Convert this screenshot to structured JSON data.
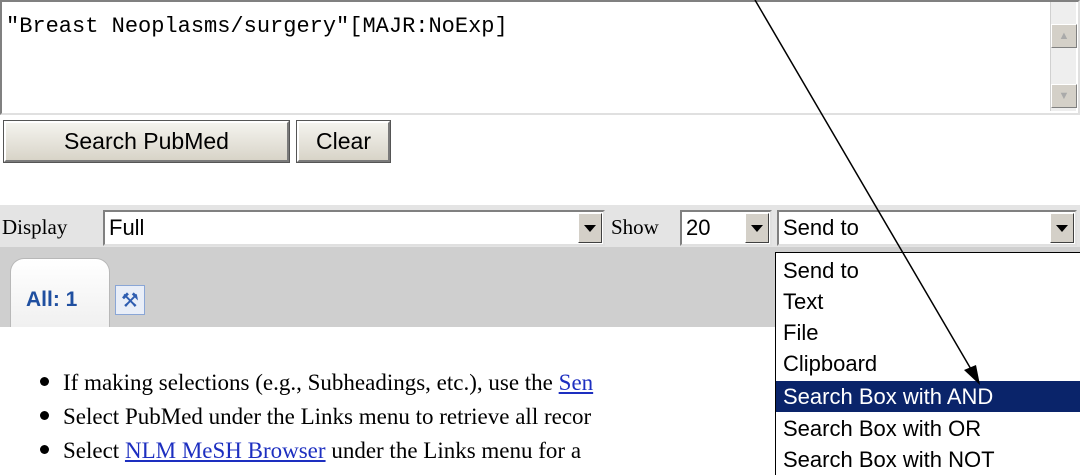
{
  "search": {
    "query": "\"Breast Neoplasms/surgery\"[MAJR:NoExp]",
    "search_button": "Search PubMed",
    "clear_button": "Clear"
  },
  "display_bar": {
    "display_label": "Display",
    "display_value": "Full",
    "show_label": "Show",
    "show_value": "20",
    "sendto_value": "Send to"
  },
  "tabs": {
    "all_label": "All: 1"
  },
  "sendto_menu": {
    "options": [
      "Send to",
      "Text",
      "File",
      "Clipboard",
      "Search Box with AND",
      "Search Box with OR",
      "Search Box with NOT"
    ],
    "selected": "Search Box with AND"
  },
  "bullets": [
    {
      "text": "If making selections (e.g., Subheadings, etc.), use the ",
      "link": "Sen"
    },
    {
      "text": "Select PubMed under the Links menu to retrieve all recor",
      "link": ""
    },
    {
      "pre": "Select ",
      "link": "NLM MeSH Browser",
      "post": " under the Links menu for a"
    }
  ],
  "icons": {
    "scroll_up": "arrow-up-icon",
    "scroll_down": "arrow-down-icon",
    "tools": "tools-icon",
    "dropdown": "chevron-down-icon"
  },
  "colors": {
    "selection": "#0a246a",
    "link": "#1d2fc0",
    "tab_label": "#1f4fa0"
  }
}
